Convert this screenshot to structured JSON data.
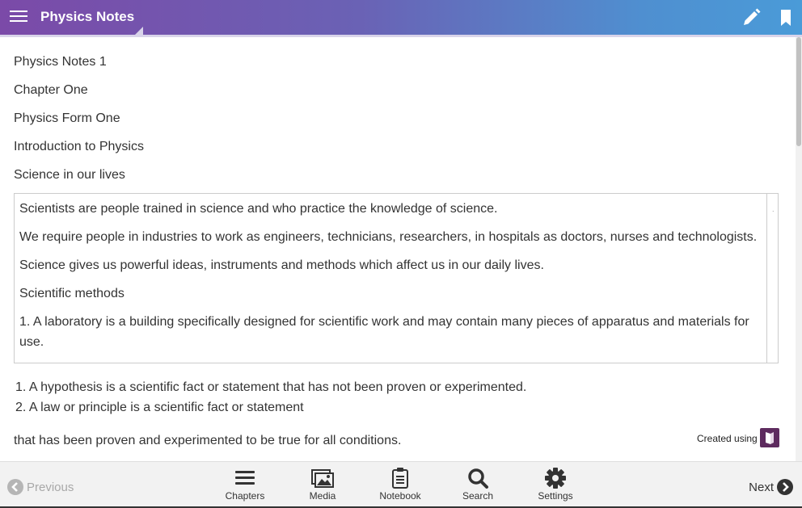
{
  "header": {
    "title": "Physics Notes"
  },
  "content": {
    "lines": [
      "Physics Notes 1",
      "Chapter One",
      "Physics Form One",
      "Introduction to Physics",
      "Science in our lives"
    ],
    "box": [
      "Scientists are people trained in science and who practice the knowledge of science.",
      "We require people in industries to work as engineers, technicians, researchers, in hospitals as doctors, nurses and technologists.",
      "Science gives us powerful ideas, instruments and methods which affect us in our daily lives.",
      "Scientific methods",
      "1. A laboratory is a building specifically designed for scientific work and may contain many pieces of apparatus and materials for use."
    ],
    "box_dot": ".",
    "list": [
      "1. A hypothesis is a scientific fact or statement that has not been proven or experimented.",
      "2. A law or principle is a scientific fact or statement"
    ],
    "continuation": "that has been proven and experimented to be true for all conditions.",
    "created_using": "Created using"
  },
  "footer": {
    "previous": "Previous",
    "next": "Next",
    "nav": [
      {
        "label": "Chapters",
        "icon": "list-icon"
      },
      {
        "label": "Media",
        "icon": "image-icon"
      },
      {
        "label": "Notebook",
        "icon": "notebook-icon"
      },
      {
        "label": "Search",
        "icon": "search-icon"
      },
      {
        "label": "Settings",
        "icon": "gear-icon"
      }
    ]
  },
  "colors": {
    "header_start": "#7b4aa8",
    "header_end": "#4a9bd8",
    "logo": "#5e2b5f"
  }
}
